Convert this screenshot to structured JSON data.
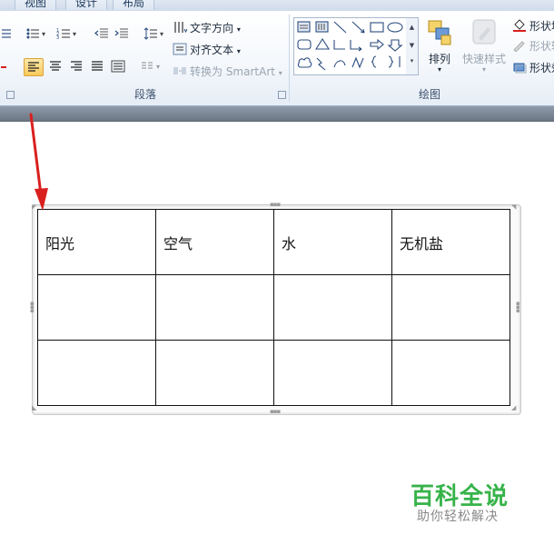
{
  "ribbon": {
    "tabs": [
      "视图",
      "设计",
      "布局"
    ],
    "paragraph_group": {
      "label": "段落",
      "text_direction": "文字方向",
      "align_text": "对齐文本",
      "convert_smartart": "转换为 SmartArt"
    },
    "drawing_group": {
      "label": "绘图",
      "arrange": "排列",
      "quick_styles": "快速样式",
      "shape_fill": "形状填",
      "shape_outline": "形状轮",
      "shape_effects": "形状效"
    }
  },
  "table": {
    "rows": [
      [
        "阳光",
        "空气",
        "水",
        "无机盐"
      ],
      [
        "",
        "",
        "",
        ""
      ],
      [
        "",
        "",
        "",
        ""
      ]
    ]
  },
  "watermark": {
    "title": "百科全说",
    "subtitle": "助你轻松解决"
  },
  "colors": {
    "arrow": "#d9201e",
    "watermark_green": "#37b34a",
    "active_button": "#f9c95c"
  }
}
